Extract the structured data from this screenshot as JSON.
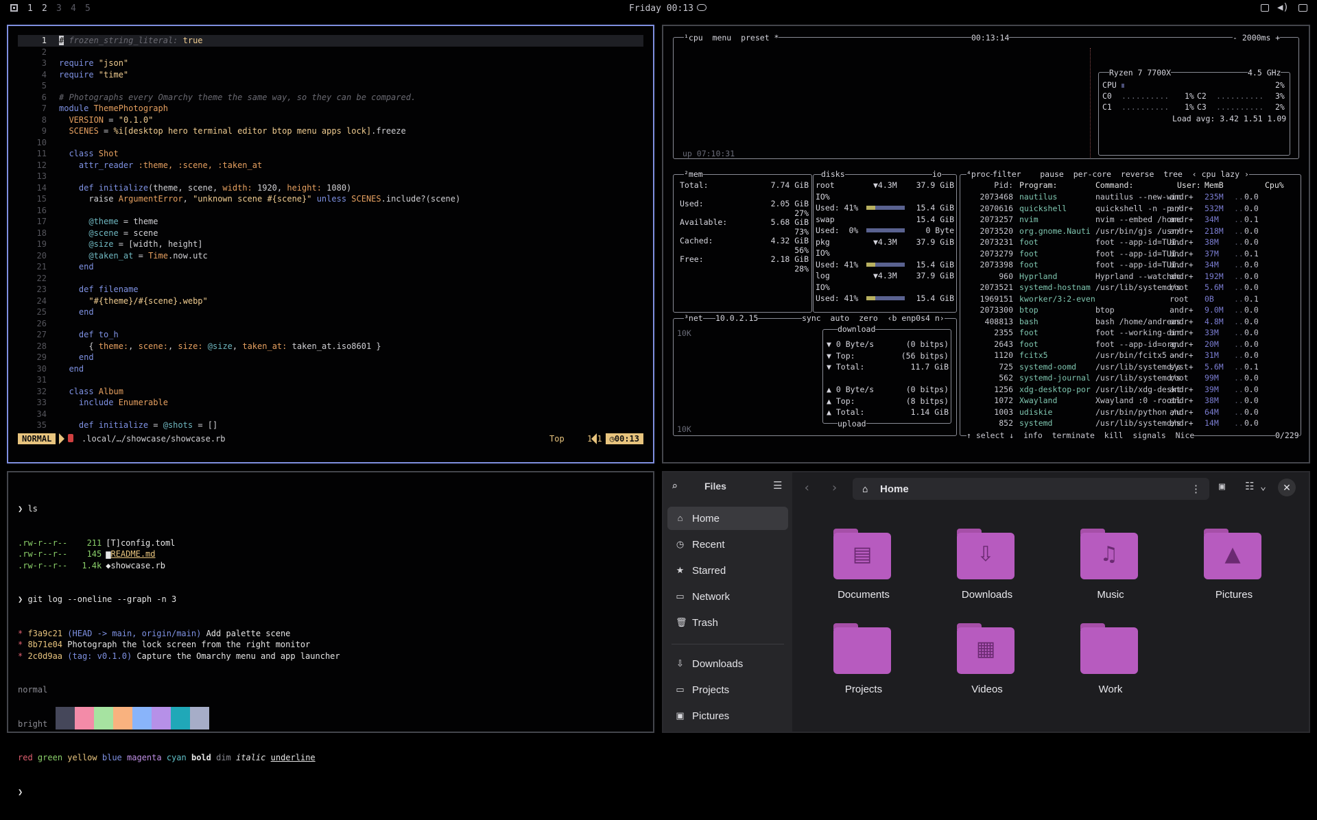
{
  "topbar": {
    "workspaces": [
      "1",
      "2",
      "3",
      "4",
      "5"
    ],
    "clock": "Friday 00:13"
  },
  "editor": {
    "lines": [
      [
        [
          "cursor",
          "#"
        ],
        [
          "c-com",
          " frozen_string_literal:"
        ],
        [
          "c-str",
          " true"
        ]
      ],
      [],
      [
        [
          "c-kw",
          "require "
        ],
        [
          "c-str",
          "\"json\""
        ]
      ],
      [
        [
          "c-kw",
          "require "
        ],
        [
          "c-str",
          "\"time\""
        ]
      ],
      [],
      [
        [
          "c-com",
          "# Photographs every Omarchy theme the same way, so they can be compared."
        ]
      ],
      [
        [
          "c-kw",
          "module "
        ],
        [
          "c-cls",
          "ThemePhotograph"
        ]
      ],
      [
        [
          "c-cls",
          "  VERSION"
        ],
        [
          "c-txt",
          " = "
        ],
        [
          "c-str",
          "\"0.1.0\""
        ]
      ],
      [
        [
          "c-cls",
          "  SCENES"
        ],
        [
          "c-txt",
          " = "
        ],
        [
          "c-str",
          "%i[desktop hero terminal editor btop menu apps lock]"
        ],
        [
          "c-txt",
          ".freeze"
        ]
      ],
      [],
      [
        [
          "c-kw",
          "  class "
        ],
        [
          "c-cls",
          "Shot"
        ]
      ],
      [
        [
          "c-fn",
          "    attr_reader "
        ],
        [
          "c-sym",
          ":theme, :scene, :taken_at"
        ]
      ],
      [],
      [
        [
          "c-kw",
          "    def "
        ],
        [
          "c-fn",
          "initialize"
        ],
        [
          "c-txt",
          "(theme, scene, "
        ],
        [
          "c-sym",
          "width:"
        ],
        [
          "c-txt",
          " 1920, "
        ],
        [
          "c-sym",
          "height:"
        ],
        [
          "c-txt",
          " 1080)"
        ]
      ],
      [
        [
          "c-txt",
          "      raise "
        ],
        [
          "c-cls",
          "ArgumentError"
        ],
        [
          "c-txt",
          ", "
        ],
        [
          "c-str",
          "\"unknown scene #{scene}\""
        ],
        [
          "c-kw",
          " unless "
        ],
        [
          "c-cls",
          "SCENES"
        ],
        [
          "c-txt",
          ".include?(scene)"
        ]
      ],
      [],
      [
        [
          "c-ivar",
          "      @theme"
        ],
        [
          "c-txt",
          " = theme"
        ]
      ],
      [
        [
          "c-ivar",
          "      @scene"
        ],
        [
          "c-txt",
          " = scene"
        ]
      ],
      [
        [
          "c-ivar",
          "      @size"
        ],
        [
          "c-txt",
          " = [width, height]"
        ]
      ],
      [
        [
          "c-ivar",
          "      @taken_at"
        ],
        [
          "c-txt",
          " = "
        ],
        [
          "c-cls",
          "Time"
        ],
        [
          "c-txt",
          ".now.utc"
        ]
      ],
      [
        [
          "c-kw",
          "    end"
        ]
      ],
      [],
      [
        [
          "c-kw",
          "    def "
        ],
        [
          "c-fn",
          "filename"
        ]
      ],
      [
        [
          "c-str",
          "      \"#{theme}/#{scene}.webp\""
        ]
      ],
      [
        [
          "c-kw",
          "    end"
        ]
      ],
      [],
      [
        [
          "c-kw",
          "    def "
        ],
        [
          "c-fn",
          "to_h"
        ]
      ],
      [
        [
          "c-txt",
          "      { "
        ],
        [
          "c-sym",
          "theme:"
        ],
        [
          "c-txt",
          ", "
        ],
        [
          "c-sym",
          "scene:"
        ],
        [
          "c-txt",
          ", "
        ],
        [
          "c-sym",
          "size:"
        ],
        [
          "c-ivar",
          " @size"
        ],
        [
          "c-txt",
          ", "
        ],
        [
          "c-sym",
          "taken_at:"
        ],
        [
          "c-txt",
          " taken_at.iso8601 }"
        ]
      ],
      [
        [
          "c-kw",
          "    end"
        ]
      ],
      [
        [
          "c-kw",
          "  end"
        ]
      ],
      [],
      [
        [
          "c-kw",
          "  class "
        ],
        [
          "c-cls",
          "Album"
        ]
      ],
      [
        [
          "c-fn",
          "    include "
        ],
        [
          "c-cls",
          "Enumerable"
        ]
      ],
      [],
      [
        [
          "c-kw",
          "    def "
        ],
        [
          "c-fn",
          "initialize"
        ],
        [
          "c-txt",
          " = "
        ],
        [
          "c-ivar",
          "@shots"
        ],
        [
          "c-txt",
          " = []"
        ]
      ]
    ],
    "status": {
      "mode": "NORMAL",
      "path": ".local/…/showcase/showcase.rb",
      "scroll": "Top",
      "position": "1:1",
      "time": "00:13"
    }
  },
  "btop": {
    "cpu": {
      "header_tabs": "¹cpu  menu  preset *",
      "clock": "00:13:14",
      "interval": "- 2000ms +",
      "uptime": "up 07:10:31",
      "model": "Ryzen 7 7700X",
      "freq": "4.5 GHz",
      "total_label": "CPU",
      "total_pct": "2%",
      "total_frac": 0.02,
      "cores": [
        {
          "label": "C0",
          "pct": "1%"
        },
        {
          "label": "C1",
          "pct": "1%"
        },
        {
          "label": "C2",
          "pct": "3%"
        },
        {
          "label": "C3",
          "pct": "2%"
        }
      ],
      "load": "Load avg: 3.42 1.51 1.09"
    },
    "mem": {
      "title": "²mem",
      "rows": [
        {
          "label": "Total:",
          "value": "7.74 GiB",
          "pct": ""
        },
        {
          "label": "Used:",
          "value": "2.05 GiB",
          "pct": "27%"
        },
        {
          "label": "Available:",
          "value": "5.68 GiB",
          "pct": "73%"
        },
        {
          "label": "Cached:",
          "value": "4.32 GiB",
          "pct": "56%"
        },
        {
          "label": "Free:",
          "value": "2.18 GiB",
          "pct": "28%"
        }
      ]
    },
    "disks": {
      "title": "disks",
      "io": "io",
      "entries": [
        {
          "name": "root",
          "io": "▼4.3M",
          "size": "37.9 GiB",
          "io_label": "IO%",
          "used": "Used: 41%",
          "used_frac": 0.41,
          "used_size": "15.4 GiB"
        },
        {
          "name": "swap",
          "io": "",
          "size": "15.4 GiB",
          "io_label": "",
          "used": "Used:  0%",
          "used_frac": 0,
          "used_size": "0 Byte"
        },
        {
          "name": "pkg",
          "io": "▼4.3M",
          "size": "37.9 GiB",
          "io_label": "IO%",
          "used": "Used: 41%",
          "used_frac": 0.41,
          "used_size": "15.4 GiB"
        },
        {
          "name": "log",
          "io": "▼4.3M",
          "size": "37.9 GiB",
          "io_label": "IO%",
          "used": "Used: 41%",
          "used_frac": 0.41,
          "used_size": "15.4 GiB"
        }
      ]
    },
    "net": {
      "title": "³net",
      "ip": "10.0.2.15",
      "controls": "sync  auto  zero  ‹b enp0s4 n›",
      "scale_top": "10K",
      "scale_bottom": "10K",
      "download_title": "download",
      "download": [
        {
          "label": "▼ 0 Byte/s",
          "value": "(0 bitps)"
        },
        {
          "label": "▼ Top:",
          "value": "(56 bitps)"
        },
        {
          "label": "▼ Total:",
          "value": "11.7 GiB"
        }
      ],
      "upload": [
        {
          "label": "▲ 0 Byte/s",
          "value": "(0 bitps)"
        },
        {
          "label": "▲ Top:",
          "value": "(8 bitps)"
        },
        {
          "label": "▲ Total:",
          "value": "1.14 GiB"
        }
      ],
      "upload_title": "upload"
    },
    "proc": {
      "title": "⁴proc",
      "controls": "filter    pause  per-core  reverse  tree  ‹ cpu lazy ›",
      "headers": {
        "pid": "Pid:",
        "program": "Program:",
        "command": "Command:",
        "user": "User:",
        "mem": "MemB",
        "cpu": "Cpu%"
      },
      "rows": [
        [
          "2073468",
          "nautilus",
          "nautilus --new-win",
          "andr+",
          "235M",
          "0.0"
        ],
        [
          "2070616",
          "quickshell",
          "quickshell -n -p /",
          "andr+",
          "532M",
          "0.0"
        ],
        [
          "2073257",
          "nvim",
          "nvim --embed /home",
          "andr+",
          "34M",
          "0.1"
        ],
        [
          "2073520",
          "org.gnome.Nauti",
          "/usr/bin/gjs /usr/",
          "andr+",
          "218M",
          "0.0"
        ],
        [
          "2073231",
          "foot",
          "foot --app-id=TUI.",
          "andr+",
          "38M",
          "0.0"
        ],
        [
          "2073279",
          "foot",
          "foot --app-id=TUI.",
          "andr+",
          "37M",
          "0.1"
        ],
        [
          "2073398",
          "foot",
          "foot --app-id=TUI.",
          "andr+",
          "34M",
          "0.0"
        ],
        [
          "960",
          "Hyprland",
          "Hyprland --watchdo",
          "andr+",
          "192M",
          "0.0"
        ],
        [
          "2073521",
          "systemd-hostnam",
          "/usr/lib/systemd/s",
          "root",
          "5.6M",
          "0.0"
        ],
        [
          "1969151",
          "kworker/3:2-even",
          "",
          "root",
          "0B",
          "0.1"
        ],
        [
          "2073300",
          "btop",
          "btop",
          "andr+",
          "9.0M",
          "0.0"
        ],
        [
          "408813",
          "bash",
          "bash /home/andreas",
          "andr+",
          "4.8M",
          "0.0"
        ],
        [
          "2355",
          "foot",
          "foot --working-dir",
          "andr+",
          "33M",
          "0.0"
        ],
        [
          "2643",
          "foot",
          "foot --app-id=org.",
          "andr+",
          "20M",
          "0.0"
        ],
        [
          "1120",
          "fcitx5",
          "/usr/bin/fcitx5 --",
          "andr+",
          "31M",
          "0.0"
        ],
        [
          "725",
          "systemd-oomd",
          "/usr/lib/systemd/s",
          "syst+",
          "5.6M",
          "0.1"
        ],
        [
          "562",
          "systemd-journal",
          "/usr/lib/systemd/s",
          "root",
          "99M",
          "0.0"
        ],
        [
          "1256",
          "xdg-desktop-por",
          "/usr/lib/xdg-deskt",
          "andr+",
          "39M",
          "0.0"
        ],
        [
          "1072",
          "Xwayland",
          "Xwayland :0 -rootl",
          "andr+",
          "38M",
          "0.0"
        ],
        [
          "1003",
          "udiskie",
          "/usr/bin/python /u",
          "andr+",
          "64M",
          "0.0"
        ],
        [
          "852",
          "systemd",
          "/usr/lib/systemd/s",
          "andr+",
          "14M",
          "0.0"
        ]
      ],
      "footer": "↑ select ↓  info  terminate  kill  signals  Nice",
      "count": "0/229"
    }
  },
  "terminal": {
    "cmd1": "ls",
    "files": [
      {
        "perm": ".rw-r--r--",
        "size": "211",
        "icon": "[T]",
        "name": "config.toml",
        "underline": false
      },
      {
        "perm": ".rw-r--r--",
        "size": "145",
        "icon": "▆",
        "name": "README.md",
        "underline": true
      },
      {
        "perm": ".rw-r--r--",
        "size": "1.4k",
        "icon": "◆",
        "name": "showcase.rb",
        "underline": false
      }
    ],
    "cmd2": "git log --oneline --graph -n 3",
    "commits": [
      {
        "hash": "f3a9c21",
        "ref": "(HEAD -> main, origin/main)",
        "msg": "Add palette scene"
      },
      {
        "hash": "8b71e04",
        "ref": "",
        "msg": "Photograph the lock screen from the right monitor"
      },
      {
        "hash": "2c0d9aa",
        "ref": "(tag: v0.1.0)",
        "msg": "Capture the Omarchy menu and app launcher"
      }
    ],
    "normal_label": "normal",
    "bright_label": "bright",
    "normal_colors": [
      "#000000",
      "#000000",
      "#000000",
      "#000000",
      "#000000",
      "#000000",
      "#000000",
      "#000000"
    ],
    "bright_colors": [
      "#45475a",
      "#f38ba8",
      "#a6e3a1",
      "#f9b27f",
      "#89b4fa",
      "#b690e8",
      "#20a8b8",
      "#a6adc8"
    ],
    "styles": [
      "red",
      "green",
      "yellow",
      "blue",
      "magenta",
      "cyan",
      "bold",
      "dim",
      "italic",
      "underline"
    ]
  },
  "files": {
    "title": "Files",
    "sidebar": [
      {
        "label": "Home",
        "icon": "home-icon",
        "glyph": "⌂",
        "selected": true
      },
      {
        "label": "Recent",
        "icon": "clock-icon",
        "glyph": "◷"
      },
      {
        "label": "Starred",
        "icon": "star-icon",
        "glyph": "★"
      },
      {
        "label": "Network",
        "icon": "network-icon",
        "glyph": "▭"
      },
      {
        "label": "Trash",
        "icon": "trash-icon",
        "glyph": "🗑"
      }
    ],
    "bookmarks": [
      {
        "label": "Downloads",
        "icon": "download-icon",
        "glyph": "⇩"
      },
      {
        "label": "Projects",
        "icon": "folder-icon",
        "glyph": "▭"
      },
      {
        "label": "Pictures",
        "icon": "image-icon",
        "glyph": "▣"
      }
    ],
    "path": "Home",
    "folders": [
      {
        "name": "Documents",
        "glyph": "▤",
        "icon": "document-folder-icon"
      },
      {
        "name": "Downloads",
        "glyph": "⇩",
        "icon": "download-folder-icon"
      },
      {
        "name": "Music",
        "glyph": "♫",
        "icon": "music-folder-icon"
      },
      {
        "name": "Pictures",
        "glyph": "▲",
        "icon": "pictures-folder-icon"
      },
      {
        "name": "Projects",
        "glyph": "",
        "icon": "folder-icon"
      },
      {
        "name": "Videos",
        "glyph": "▦",
        "icon": "videos-folder-icon"
      },
      {
        "name": "Work",
        "glyph": "",
        "icon": "folder-icon"
      }
    ],
    "close": "✕"
  }
}
